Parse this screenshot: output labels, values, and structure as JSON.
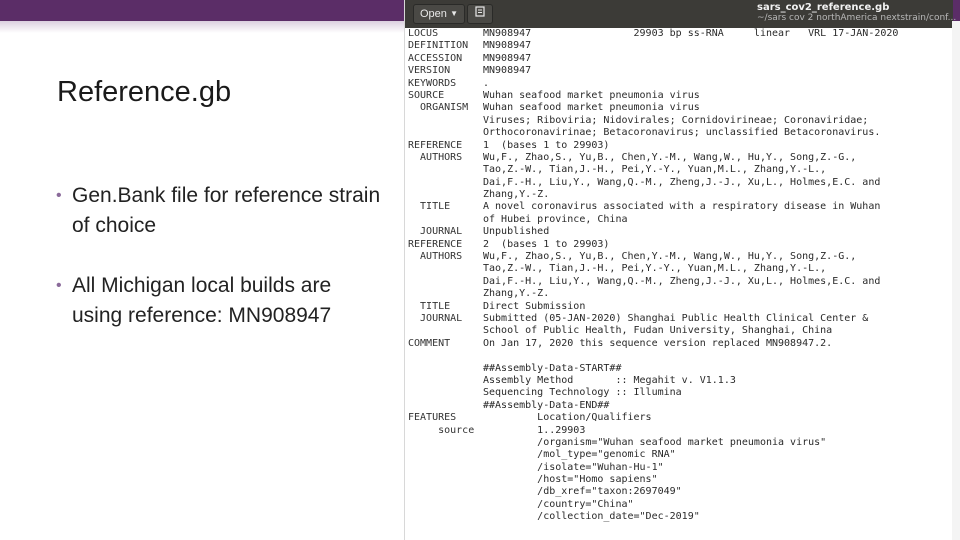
{
  "slide": {
    "title": "Reference.gb",
    "bullets": [
      "Gen.Bank file for reference strain of choice",
      "All Michigan local builds are using reference: MN908947"
    ],
    "accent": "#5b2d67"
  },
  "editor": {
    "open_label": "Open",
    "file_name": "sars_cov2_reference.gb",
    "file_path": "~/sars cov 2 northAmerica nextstrain/conf...",
    "lines": [
      {
        "k": "LOCUS",
        "v": "MN908947                 29903 bp ss-RNA     linear   VRL 17-JAN-2020"
      },
      {
        "k": "DEFINITION",
        "v": "MN908947"
      },
      {
        "k": "ACCESSION",
        "v": "MN908947"
      },
      {
        "k": "VERSION",
        "v": "MN908947"
      },
      {
        "k": "KEYWORDS",
        "v": "."
      },
      {
        "k": "SOURCE",
        "v": "Wuhan seafood market pneumonia virus"
      },
      {
        "k": "  ORGANISM",
        "v": "Wuhan seafood market pneumonia virus"
      },
      {
        "k": "",
        "v": "Viruses; Riboviria; Nidovirales; Cornidovirineae; Coronaviridae;"
      },
      {
        "k": "",
        "v": "Orthocoronavirinae; Betacoronavirus; unclassified Betacoronavirus."
      },
      {
        "k": "REFERENCE",
        "v": "1  (bases 1 to 29903)"
      },
      {
        "k": "  AUTHORS",
        "v": "Wu,F., Zhao,S., Yu,B., Chen,Y.-M., Wang,W., Hu,Y., Song,Z.-G.,"
      },
      {
        "k": "",
        "v": "Tao,Z.-W., Tian,J.-H., Pei,Y.-Y., Yuan,M.L., Zhang,Y.-L.,"
      },
      {
        "k": "",
        "v": "Dai,F.-H., Liu,Y., Wang,Q.-M., Zheng,J.-J., Xu,L., Holmes,E.C. and"
      },
      {
        "k": "",
        "v": "Zhang,Y.-Z."
      },
      {
        "k": "  TITLE",
        "v": "A novel coronavirus associated with a respiratory disease in Wuhan"
      },
      {
        "k": "",
        "v": "of Hubei province, China"
      },
      {
        "k": "  JOURNAL",
        "v": "Unpublished"
      },
      {
        "k": "REFERENCE",
        "v": "2  (bases 1 to 29903)"
      },
      {
        "k": "  AUTHORS",
        "v": "Wu,F., Zhao,S., Yu,B., Chen,Y.-M., Wang,W., Hu,Y., Song,Z.-G.,"
      },
      {
        "k": "",
        "v": "Tao,Z.-W., Tian,J.-H., Pei,Y.-Y., Yuan,M.L., Zhang,Y.-L.,"
      },
      {
        "k": "",
        "v": "Dai,F.-H., Liu,Y., Wang,Q.-M., Zheng,J.-J., Xu,L., Holmes,E.C. and"
      },
      {
        "k": "",
        "v": "Zhang,Y.-Z."
      },
      {
        "k": "  TITLE",
        "v": "Direct Submission"
      },
      {
        "k": "  JOURNAL",
        "v": "Submitted (05-JAN-2020) Shanghai Public Health Clinical Center &"
      },
      {
        "k": "",
        "v": "School of Public Health, Fudan University, Shanghai, China"
      },
      {
        "k": "COMMENT",
        "v": "On Jan 17, 2020 this sequence version replaced MN908947.2."
      },
      {
        "k": "",
        "v": ""
      },
      {
        "k": "",
        "v": "##Assembly-Data-START##"
      },
      {
        "k": "",
        "v": "Assembly Method       :: Megahit v. V1.1.3"
      },
      {
        "k": "",
        "v": "Sequencing Technology :: Illumina"
      },
      {
        "k": "",
        "v": "##Assembly-Data-END##"
      },
      {
        "k": "FEATURES",
        "v": "         Location/Qualifiers"
      },
      {
        "k": "     source",
        "v": "         1..29903"
      },
      {
        "k": "",
        "v": "         /organism=\"Wuhan seafood market pneumonia virus\""
      },
      {
        "k": "",
        "v": "         /mol_type=\"genomic RNA\""
      },
      {
        "k": "",
        "v": "         /isolate=\"Wuhan-Hu-1\""
      },
      {
        "k": "",
        "v": "         /host=\"Homo sapiens\""
      },
      {
        "k": "",
        "v": "         /db_xref=\"taxon:2697049\""
      },
      {
        "k": "",
        "v": "         /country=\"China\""
      },
      {
        "k": "",
        "v": "         /collection_date=\"Dec-2019\""
      }
    ]
  }
}
